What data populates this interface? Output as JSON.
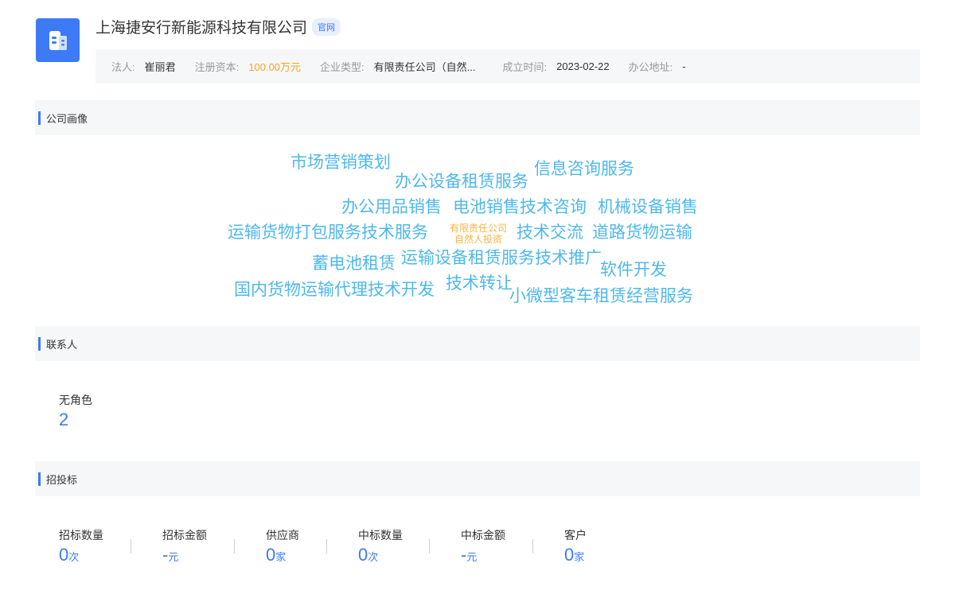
{
  "company": {
    "name": "上海捷安行新能源科技有限公司",
    "official_tag": "官网"
  },
  "info": {
    "legal_rep_label": "法人:",
    "legal_rep": "崔丽君",
    "capital_label": "注册资本:",
    "capital": "100.00万元",
    "type_label": "企业类型:",
    "type": "有限责任公司（自然...",
    "founded_label": "成立时间:",
    "founded": "2023-02-22",
    "address_label": "办公地址:",
    "address": "-"
  },
  "portrait": {
    "title": "公司画像",
    "words": [
      "市场营销策划",
      "办公设备租赁服务",
      "信息咨询服务",
      "办公用品销售",
      "电池销售技术咨询",
      "机械设备销售",
      "运输货物打包服务技术服务",
      "技术交流",
      "道路货物运输",
      "蓄电池租赁",
      "运输设备租赁服务技术推广",
      "软件开发",
      "国内货物运输代理技术开发",
      "技术转让",
      "小微型客车租赁经营服务"
    ],
    "center_line1": "有限责任公司",
    "center_line2": "自然人投资",
    "colors": {
      "word": "#4fb8eb",
      "center": "#f5b445"
    }
  },
  "contacts": {
    "title": "联系人",
    "role_label": "无角色",
    "role_count": "2"
  },
  "bidding": {
    "title": "招投标",
    "stats": [
      {
        "label": "招标数量",
        "value": "0",
        "unit": "次"
      },
      {
        "label": "招标金额",
        "value": "-",
        "unit": "元"
      },
      {
        "label": "供应商",
        "value": "0",
        "unit": "家"
      },
      {
        "label": "中标数量",
        "value": "0",
        "unit": "次"
      },
      {
        "label": "中标金额",
        "value": "-",
        "unit": "元"
      },
      {
        "label": "客户",
        "value": "0",
        "unit": "家"
      }
    ]
  },
  "accent_color": "#3d7af5"
}
